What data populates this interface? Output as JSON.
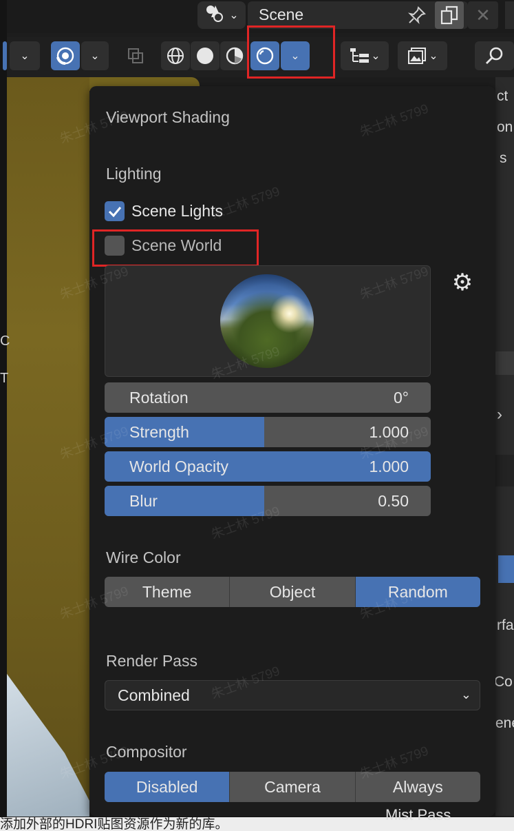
{
  "top_bar": {
    "scene_label": "Scene"
  },
  "popover": {
    "title": "Viewport Shading",
    "lighting": {
      "label": "Lighting",
      "scene_lights": {
        "label": "Scene Lights",
        "checked": true
      },
      "scene_world": {
        "label": "Scene World",
        "checked": false
      }
    },
    "sliders": [
      {
        "label": "Rotation",
        "value": "0°",
        "fill_fraction": 0.0
      },
      {
        "label": "Strength",
        "value": "1.000",
        "fill_fraction": 0.49
      },
      {
        "label": "World Opacity",
        "value": "1.000",
        "fill_fraction": 1.0
      },
      {
        "label": "Blur",
        "value": "0.50",
        "fill_fraction": 0.49
      }
    ],
    "wire_color": {
      "label": "Wire Color",
      "options": [
        "Theme",
        "Object",
        "Random"
      ],
      "selected": "Random"
    },
    "render_pass": {
      "label": "Render Pass",
      "value": "Combined"
    },
    "compositor": {
      "label": "Compositor",
      "options": [
        "Disabled",
        "Camera",
        "Always"
      ],
      "selected": "Disabled"
    }
  },
  "watermark": "朱士林 5799",
  "right_panel": {
    "fragments": [
      "ct",
      "on",
      "s",
      "rfa",
      "Co",
      "ene"
    ],
    "bottom_item": "Mist Pass"
  },
  "bottom_caption": "添加外部的HDRI贴图资源作为新的库。",
  "colors": {
    "accent_blue": "#4772b3",
    "panel_bg": "#1c1c1c",
    "widget_gray": "#545454",
    "highlight_red": "#e02525"
  }
}
